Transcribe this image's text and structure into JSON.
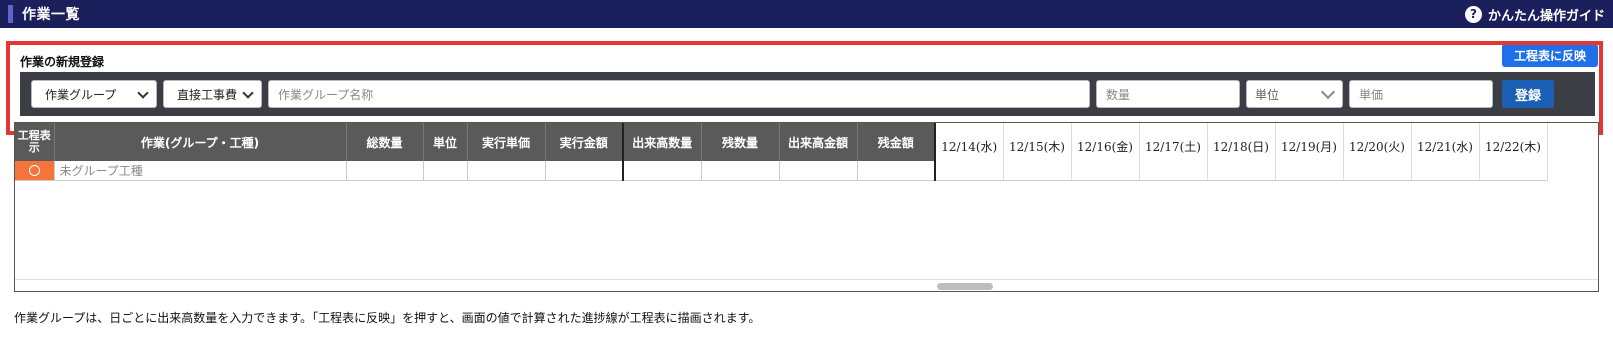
{
  "header": {
    "title": "作業一覧",
    "guide_label": "かんたん操作ガイド",
    "guide_icon": "question-circle-icon"
  },
  "registration": {
    "title": "作業の新規登録",
    "reflect_button": "工程表に反映",
    "group_select": "作業グループ",
    "cost_select": "直接工事費",
    "name_placeholder": "作業グループ名称",
    "quantity_placeholder": "数量",
    "unit_select": "単位",
    "price_placeholder": "単価",
    "submit_button": "登録"
  },
  "table": {
    "columns": {
      "show_schedule": "工程表示",
      "work": "作業(グループ・工種)",
      "total_qty": "総数量",
      "unit": "単位",
      "exec_price": "実行単価",
      "exec_amount": "実行金額",
      "done_qty": "出来高数量",
      "remain_qty": "残数量",
      "done_amount": "出来高金額",
      "remain_amount": "残金額"
    },
    "dates": [
      "12/14(水)",
      "12/15(木)",
      "12/16(金)",
      "12/17(土)",
      "12/18(日)",
      "12/19(月)",
      "12/20(火)",
      "12/21(水)",
      "12/22(木)"
    ],
    "rows": [
      {
        "name": "未グループ工種"
      }
    ]
  },
  "note": "作業グループは、日ごとに出来高数量を入力できます。「工程表に反映」を押すと、画面の値で計算された進捗線が工程表に描画されます。",
  "colors": {
    "header_bg": "#1b1f5c",
    "accent_blue": "#1e6fe8",
    "submit_blue": "#1a5fb4",
    "form_bar": "#3b3e44",
    "table_header": "#5a5a5a",
    "orange": "#f4743a",
    "highlight_red": "#e53535"
  }
}
